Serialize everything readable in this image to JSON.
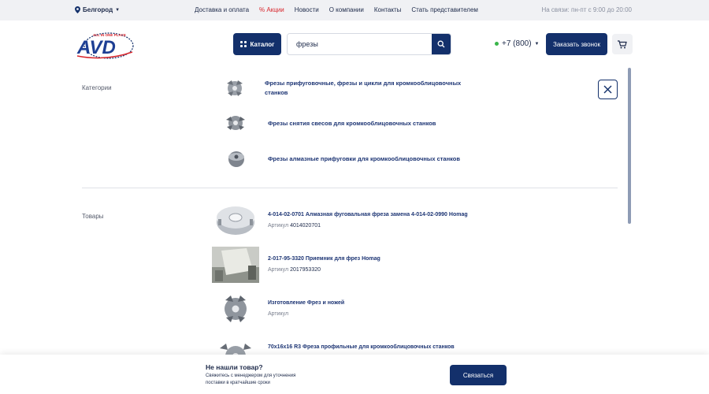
{
  "topbar": {
    "city": "Белгород",
    "nav": [
      "Доставка и оплата",
      "Акции",
      "Новости",
      "О компании",
      "Контакты",
      "Стать представителем"
    ],
    "hours": "На связи: пн-пт с 9:00 до 20:00"
  },
  "header": {
    "logo_text": "AVD",
    "logo_tagline": "ALL IN ONE PLACE",
    "catalog_label": "Каталог",
    "search_value": "фрезы",
    "phone": "+7 (800)",
    "callback_label": "Заказать звонок"
  },
  "categories": {
    "label": "Категории",
    "items": [
      "Фрезы прифуговочные, фрезы и цикли для кромкооблицовочных станков",
      "Фрезы снятия свесов для кромкооблицовочных станков",
      "Фрезы алмазные прифуговки для кромкооблицовочных станков"
    ]
  },
  "products": {
    "label": "Товары",
    "sku_label": "Артикул",
    "items": [
      {
        "title": "4-014-02-0701 Алмазная фуговальная фреза замена 4-014-02-0990 Homag",
        "sku": "4014020701"
      },
      {
        "title": "2-017-95-3320 Приемник для фрез Homag",
        "sku": "2017953320"
      },
      {
        "title": "Изготовление Фрез и ножей",
        "sku": ""
      },
      {
        "title": "70x16x16 R3 Фреза профильные для кромкооблицовочных станков",
        "sku": ""
      }
    ]
  },
  "bottom": {
    "title": "Не нашли товар?",
    "text": "Свяжитесь с менеджером для уточнения поставки в кратчайшие сроки",
    "button": "Связаться"
  },
  "colors": {
    "brand": "#13306b",
    "promo": "#d8262c",
    "online": "#3ab54a"
  }
}
